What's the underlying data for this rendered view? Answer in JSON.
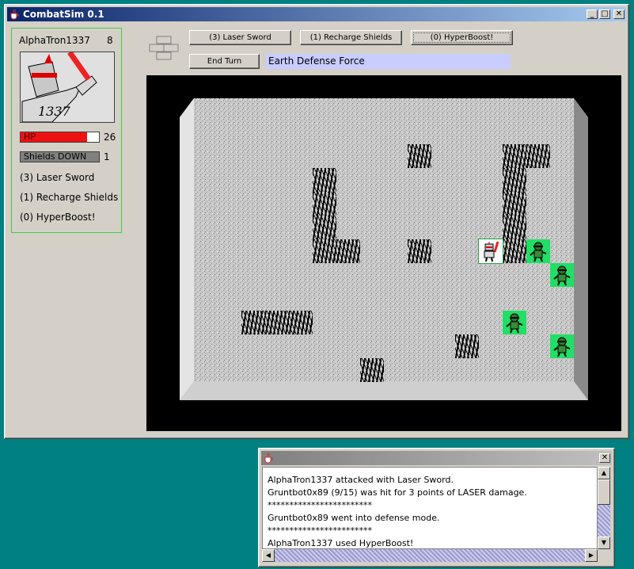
{
  "main_window": {
    "title": "CombatSim 0.1",
    "minimize_label": "_",
    "maximize_label": "□",
    "close_label": "✕"
  },
  "player": {
    "name": "AlphaTron1337",
    "level": "8",
    "portrait_text": "1337",
    "hp_label": "HP",
    "hp_value": "26",
    "hp_fraction": 0.85,
    "shields_label": "Shields DOWN",
    "shields_value": "1",
    "abilities": [
      "(3) Laser Sword",
      "(1) Recharge Shields",
      "(0) HyperBoost!"
    ]
  },
  "toolbar": {
    "buttons": [
      "(3) Laser Sword",
      "(1) Recharge Shields",
      "(0) HyperBoost!"
    ],
    "end_turn_label": "End Turn",
    "team_name": "Earth Defense Force"
  },
  "board": {
    "cols": 16,
    "rows": 12,
    "walls": [
      [
        5,
        3
      ],
      [
        5,
        4
      ],
      [
        5,
        5
      ],
      [
        5,
        6
      ],
      [
        6,
        6
      ],
      [
        9,
        2
      ],
      [
        9,
        6
      ],
      [
        13,
        2
      ],
      [
        14,
        2
      ],
      [
        13,
        3
      ],
      [
        13,
        4
      ],
      [
        13,
        5
      ],
      [
        13,
        6
      ],
      [
        2,
        9
      ],
      [
        3,
        9
      ],
      [
        4,
        9
      ],
      [
        11,
        10
      ],
      [
        7,
        11
      ]
    ],
    "player": [
      12,
      6
    ],
    "enemies": [
      [
        14,
        6
      ],
      [
        15,
        7
      ],
      [
        13,
        9
      ],
      [
        15,
        10
      ]
    ]
  },
  "log_window": {
    "lines": [
      "AlphaTron1337 attacked with Laser Sword.",
      "Gruntbot0x89 (9/15) was hit for 3 points of LASER damage.",
      "************************",
      "Gruntbot0x89 went into defense mode.",
      "************************",
      "AlphaTron1337 used HyperBoost!"
    ],
    "close_label": "✕"
  },
  "colors": {
    "hp": "#ee1111",
    "shields": "#808080",
    "team_banner": "#c8ccff",
    "enemy_tile": "#22dd66",
    "panel_border": "#44cc44"
  }
}
